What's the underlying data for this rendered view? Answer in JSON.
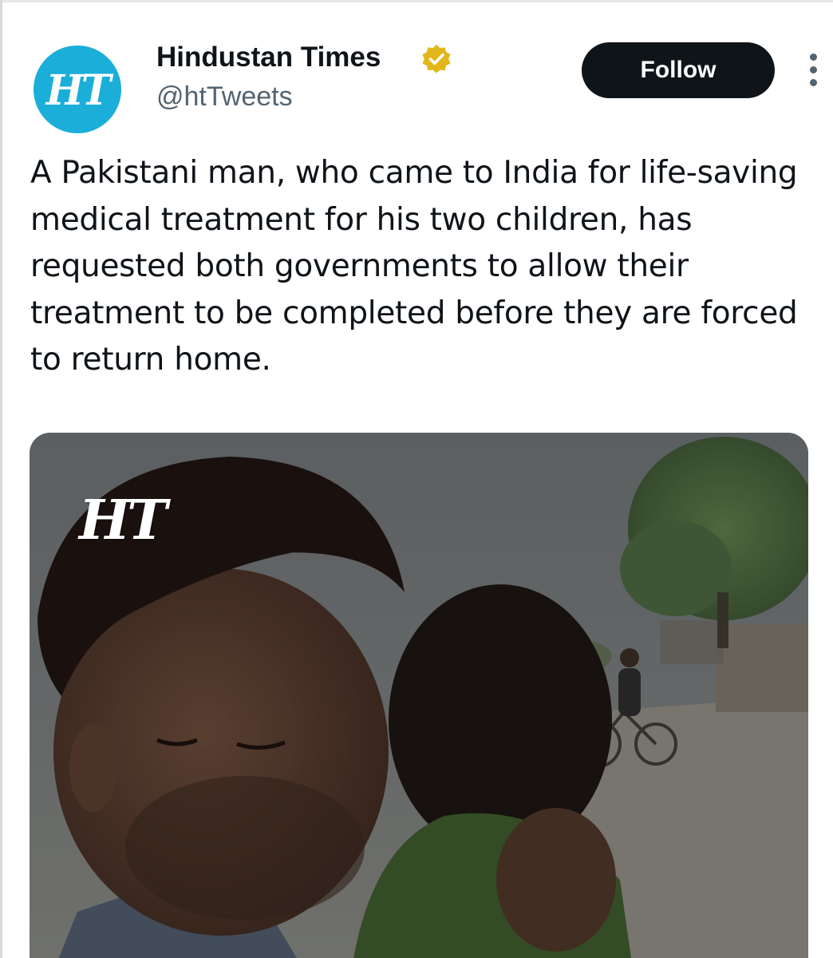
{
  "account": {
    "display_name": "Hindustan Times",
    "handle": "@htTweets",
    "avatar_text": "HT",
    "verified": true,
    "verified_badge_color": "#e2b719"
  },
  "actions": {
    "follow_label": "Follow",
    "more_icon": "more-vertical-icon"
  },
  "tweet": {
    "text": "A Pakistani man, who came to India for life-saving medical treatment for his two children, has requested both governments to allow their treatment to be completed before they are forced to return home."
  },
  "media": {
    "watermark": "HT"
  },
  "colors": {
    "brand_blue": "#1aaed9",
    "button_bg": "#0f1419",
    "secondary_text": "#536471"
  }
}
